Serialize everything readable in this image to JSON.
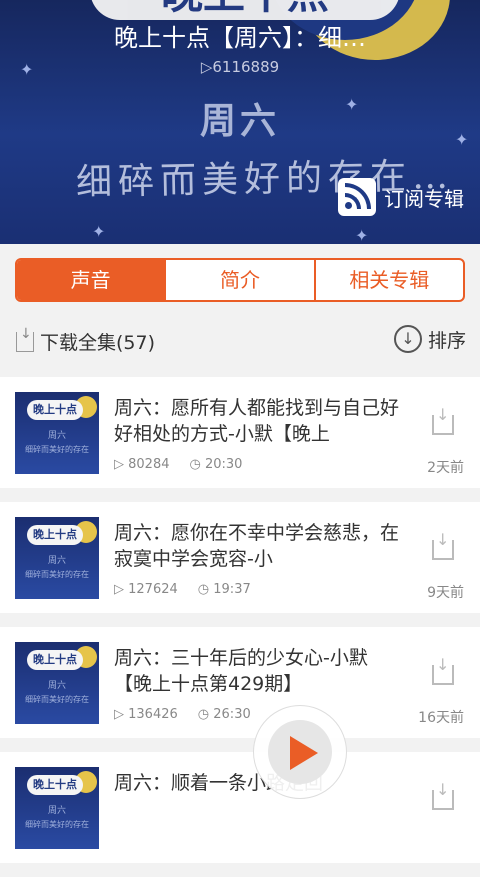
{
  "header": {
    "banner_text": "晚上十点",
    "title": "晚上十点【周六】：细…",
    "play_count": "▷6116889",
    "subtitle_line1": "周六",
    "subtitle_line2": "细碎而美好的存在…",
    "subscribe_label": "订阅专辑"
  },
  "tabs": [
    {
      "label": "声音",
      "active": true
    },
    {
      "label": "简介",
      "active": false
    },
    {
      "label": "相关专辑",
      "active": false
    }
  ],
  "toolbar": {
    "download_all_label": "下载全集(57)",
    "sort_label": "排序"
  },
  "thumbnail": {
    "badge": "晚上十点",
    "line1": "周六",
    "line2": "细碎而美好的存在"
  },
  "items": [
    {
      "title": "周六：愿所有人都能找到与自己好好相处的方式-小默【晚上",
      "plays": "80284",
      "duration": "20:30",
      "age": "2天前"
    },
    {
      "title": "周六：愿你在不幸中学会慈悲，在寂寞中学会宽容-小",
      "plays": "127624",
      "duration": "19:37",
      "age": "9天前"
    },
    {
      "title": "周六：三十年后的少女心-小默【晚上十点第429期】",
      "plays": "136426",
      "duration": "26:30",
      "age": "16天前"
    },
    {
      "title": "周六：顺着一条小路走回",
      "plays": "",
      "duration": "",
      "age": ""
    }
  ],
  "colors": {
    "accent": "#ea5d26",
    "header_bg": "#1f3a86"
  }
}
